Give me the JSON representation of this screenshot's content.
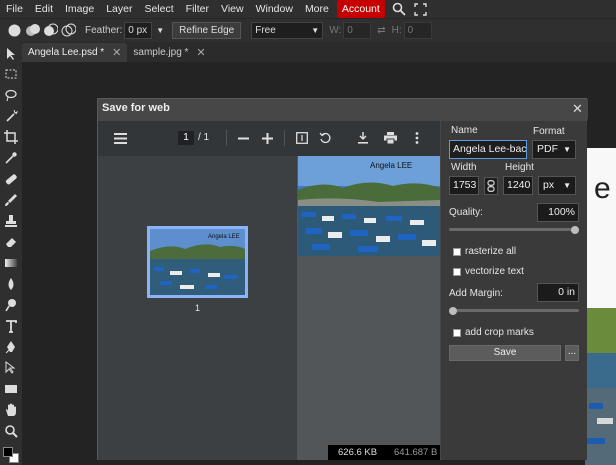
{
  "menubar": {
    "items": [
      "File",
      "Edit",
      "Image",
      "Layer",
      "Select",
      "Filter",
      "View",
      "Window",
      "More"
    ],
    "account": "Account"
  },
  "options": {
    "feather_label": "Feather:",
    "feather_value": "0 px",
    "refine_edge": "Refine Edge",
    "mode": "Free",
    "w_label": "W:",
    "w_value": "0",
    "h_label": "H:",
    "h_value": "0"
  },
  "tabs": [
    {
      "label": "Angela Lee.psd *"
    },
    {
      "label": "sample.jpg *"
    }
  ],
  "dialog": {
    "title": "Save for web",
    "pdf": {
      "page": "1",
      "page_total": "/ 1",
      "thumb_number": "1",
      "image_caption": "Angela LEE"
    },
    "sizes": {
      "left": "626.6 KB",
      "right": "641.687 B"
    },
    "panel": {
      "name_label": "Name",
      "name_value": "Angela Lee-back",
      "format_label": "Format",
      "format_value": "PDF",
      "width_label": "Width",
      "height_label": "Height",
      "width_value": "1753",
      "height_value": "1240",
      "unit_value": "px",
      "quality_label": "Quality:",
      "quality_value": "100%",
      "quality_level": 1.0,
      "rasterize_label": "rasterize all",
      "vectorize_label": "vectorize text",
      "margin_label": "Add Margin:",
      "margin_value": "0 in",
      "margin_level": 0.0,
      "crop_label": "add crop marks",
      "save_label": "Save",
      "more_label": "..."
    }
  },
  "background_text": "e",
  "colors": {
    "accent": "#c40000",
    "focus": "#5f9be0",
    "thumb_border": "#8ab4f8"
  }
}
